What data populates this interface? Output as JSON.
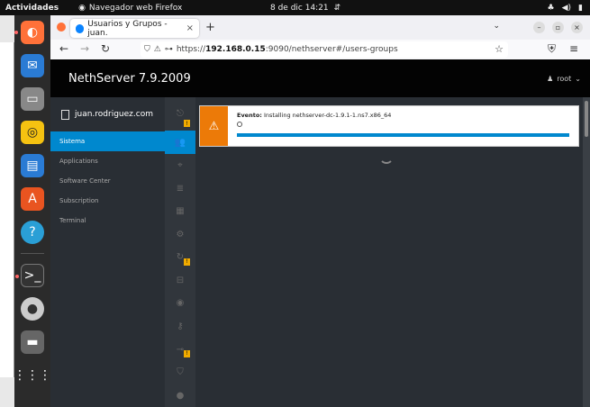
{
  "topbar": {
    "activities": "Actividades",
    "app_name": "Navegador web Firefox",
    "clock": "8 de dic 14:21"
  },
  "dock": {
    "apps": [
      "firefox-icon",
      "thunderbird-icon",
      "files-icon",
      "rhythmbox-icon",
      "writer-icon",
      "software-icon",
      "help-icon",
      "terminal-icon",
      "disc-icon",
      "trash-icon",
      "app-grid-icon"
    ]
  },
  "browser": {
    "tab_title": "Usuarios y Grupos - juan.",
    "url_scheme": "https://",
    "url_host": "192.168.0.15",
    "url_path": ":9090/nethserver#/users-groups"
  },
  "cockpit": {
    "brand": "NethServer 7.9.2009",
    "user": "root",
    "host": "juan.rodriguez.com",
    "nav": [
      "Sistema",
      "Applications",
      "Software Center",
      "Subscription",
      "Terminal"
    ],
    "active_nav": "Sistema"
  },
  "notification": {
    "label": "Evento:",
    "message": "Installing nethserver-dc-1.9.1-1.ns7.x86_64",
    "progress": 1.0
  },
  "colors": {
    "accent": "#0088ce",
    "warning": "#ec7a08",
    "header": "#030303",
    "sidebar": "#292e34"
  }
}
